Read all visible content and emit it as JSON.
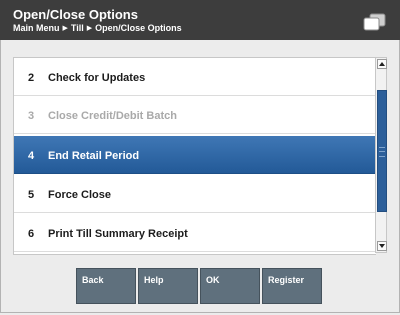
{
  "header": {
    "title": "Open/Close Options",
    "breadcrumb": [
      "Main Menu",
      "Till",
      "Open/Close Options"
    ],
    "separator_glyph": "▶",
    "icon": "windows-icon"
  },
  "list": {
    "items": [
      {
        "number": "2",
        "label": "Check for Updates",
        "state": "normal"
      },
      {
        "number": "3",
        "label": "Close Credit/Debit Batch",
        "state": "disabled"
      },
      {
        "number": "4",
        "label": "End Retail Period",
        "state": "selected"
      },
      {
        "number": "5",
        "label": "Force Close",
        "state": "normal"
      },
      {
        "number": "6",
        "label": "Print Till Summary Receipt",
        "state": "normal"
      }
    ],
    "selected_color": "#2f68a8"
  },
  "buttons": [
    {
      "label": "Back"
    },
    {
      "label": "Help"
    },
    {
      "label": "OK"
    },
    {
      "label": "Register"
    }
  ],
  "colors": {
    "header_bg": "#3d3d3d",
    "button_bg": "#5f707d",
    "scroll_thumb": "#2c5f9a"
  }
}
